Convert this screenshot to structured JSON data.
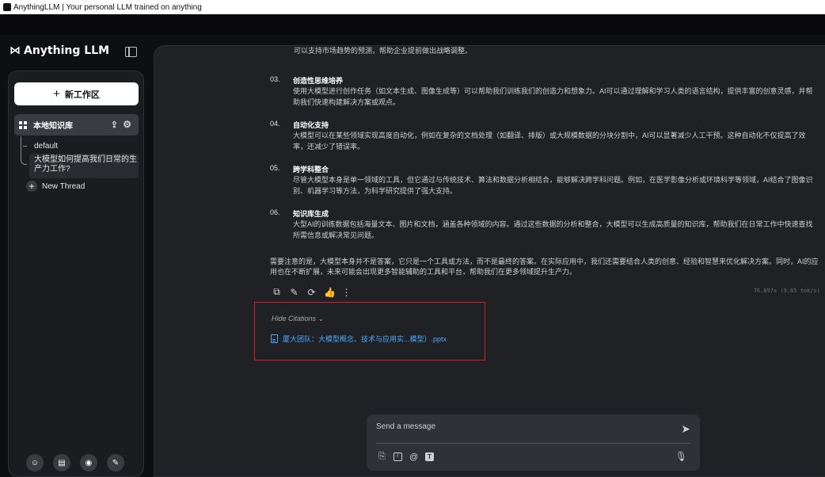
{
  "window": {
    "title": "AnythingLLM | Your personal LLM trained on anything"
  },
  "brand": {
    "name": "Anything LLM",
    "logo_glyph": "⋈"
  },
  "sidebar": {
    "new_workspace_label": "新工作区",
    "workspace": {
      "name": "本地知识库"
    },
    "threads": [
      {
        "label": "default"
      },
      {
        "label": "大模型如何提高我们日常的生产力工作?"
      }
    ],
    "new_thread_label": "New Thread",
    "footer_icons": [
      "community-icon",
      "book-icon",
      "discord-icon",
      "wrench-icon"
    ]
  },
  "chat": {
    "clipped_top": "可以支持市场趋势的预测，帮助企业提前做出战略调整。",
    "items": [
      {
        "num": "03.",
        "title": "创造性思维培养",
        "body": "使用大模型进行创作任务（如文本生成、图像生成等）可以帮助我们训练我们的创造力和想象力。AI可以通过理解和学习人类的语言结构，提供丰富的创意灵感，并帮助我们快速构建解决方案或观点。"
      },
      {
        "num": "04.",
        "title": "自动化支持",
        "body": "大模型可以在某些领域实现高度自动化，例如在复杂的文档处理（如翻译、排版）或大规模数据的分块分割中，AI可以显著减少人工干预。这种自动化不仅提高了效率，还减少了错误率。"
      },
      {
        "num": "05.",
        "title": "跨学科整合",
        "body": "尽管大模型本身是单一领域的工具，但它通过与传统技术、算法和数据分析相结合，能够解决跨学科问题。例如，在医学影像分析或环境科学等领域，AI结合了图像识别、机器学习等方法，为科学研究提供了强大支持。"
      },
      {
        "num": "06.",
        "title": "知识库生成",
        "body": "大型AI的训练数据包括海量文本、图片和文档，涵盖各种领域的内容。通过这些数据的分析和整合，大模型可以生成高质量的知识库，帮助我们在日常工作中快速查找所需信息或解决常见问题。"
      }
    ],
    "summary": "需要注意的是，大模型本身并不是答案，它只是一个工具或方法，而不是最终的答案。在实际应用中，我们还需要结合人类的创意、经验和智慧来优化解决方案。同时，AI的应用也在不断扩展，未来可能会出现更多智能辅助的工具和平台，帮助我们在更多领域提升生产力。",
    "stats": "76.897s (9.65 tok/s)",
    "hide_citations_label": "Hide Citations",
    "citation_file": "厦大团队：大模型概念、技术与应用实...模型）.pptx"
  },
  "composer": {
    "placeholder": "Send a message"
  }
}
